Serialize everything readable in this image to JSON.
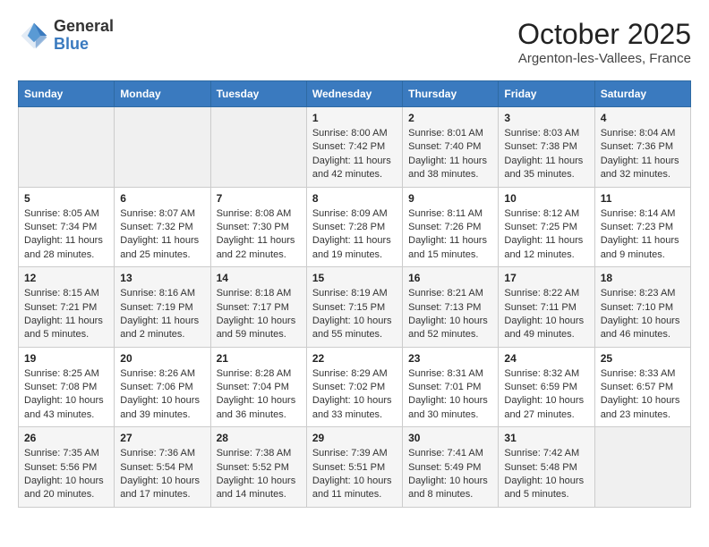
{
  "header": {
    "logo_general": "General",
    "logo_blue": "Blue",
    "month_title": "October 2025",
    "location": "Argenton-les-Vallees, France"
  },
  "days_of_week": [
    "Sunday",
    "Monday",
    "Tuesday",
    "Wednesday",
    "Thursday",
    "Friday",
    "Saturday"
  ],
  "weeks": [
    [
      {
        "day": "",
        "info": ""
      },
      {
        "day": "",
        "info": ""
      },
      {
        "day": "",
        "info": ""
      },
      {
        "day": "1",
        "info": "Sunrise: 8:00 AM\nSunset: 7:42 PM\nDaylight: 11 hours and 42 minutes."
      },
      {
        "day": "2",
        "info": "Sunrise: 8:01 AM\nSunset: 7:40 PM\nDaylight: 11 hours and 38 minutes."
      },
      {
        "day": "3",
        "info": "Sunrise: 8:03 AM\nSunset: 7:38 PM\nDaylight: 11 hours and 35 minutes."
      },
      {
        "day": "4",
        "info": "Sunrise: 8:04 AM\nSunset: 7:36 PM\nDaylight: 11 hours and 32 minutes."
      }
    ],
    [
      {
        "day": "5",
        "info": "Sunrise: 8:05 AM\nSunset: 7:34 PM\nDaylight: 11 hours and 28 minutes."
      },
      {
        "day": "6",
        "info": "Sunrise: 8:07 AM\nSunset: 7:32 PM\nDaylight: 11 hours and 25 minutes."
      },
      {
        "day": "7",
        "info": "Sunrise: 8:08 AM\nSunset: 7:30 PM\nDaylight: 11 hours and 22 minutes."
      },
      {
        "day": "8",
        "info": "Sunrise: 8:09 AM\nSunset: 7:28 PM\nDaylight: 11 hours and 19 minutes."
      },
      {
        "day": "9",
        "info": "Sunrise: 8:11 AM\nSunset: 7:26 PM\nDaylight: 11 hours and 15 minutes."
      },
      {
        "day": "10",
        "info": "Sunrise: 8:12 AM\nSunset: 7:25 PM\nDaylight: 11 hours and 12 minutes."
      },
      {
        "day": "11",
        "info": "Sunrise: 8:14 AM\nSunset: 7:23 PM\nDaylight: 11 hours and 9 minutes."
      }
    ],
    [
      {
        "day": "12",
        "info": "Sunrise: 8:15 AM\nSunset: 7:21 PM\nDaylight: 11 hours and 5 minutes."
      },
      {
        "day": "13",
        "info": "Sunrise: 8:16 AM\nSunset: 7:19 PM\nDaylight: 11 hours and 2 minutes."
      },
      {
        "day": "14",
        "info": "Sunrise: 8:18 AM\nSunset: 7:17 PM\nDaylight: 10 hours and 59 minutes."
      },
      {
        "day": "15",
        "info": "Sunrise: 8:19 AM\nSunset: 7:15 PM\nDaylight: 10 hours and 55 minutes."
      },
      {
        "day": "16",
        "info": "Sunrise: 8:21 AM\nSunset: 7:13 PM\nDaylight: 10 hours and 52 minutes."
      },
      {
        "day": "17",
        "info": "Sunrise: 8:22 AM\nSunset: 7:11 PM\nDaylight: 10 hours and 49 minutes."
      },
      {
        "day": "18",
        "info": "Sunrise: 8:23 AM\nSunset: 7:10 PM\nDaylight: 10 hours and 46 minutes."
      }
    ],
    [
      {
        "day": "19",
        "info": "Sunrise: 8:25 AM\nSunset: 7:08 PM\nDaylight: 10 hours and 43 minutes."
      },
      {
        "day": "20",
        "info": "Sunrise: 8:26 AM\nSunset: 7:06 PM\nDaylight: 10 hours and 39 minutes."
      },
      {
        "day": "21",
        "info": "Sunrise: 8:28 AM\nSunset: 7:04 PM\nDaylight: 10 hours and 36 minutes."
      },
      {
        "day": "22",
        "info": "Sunrise: 8:29 AM\nSunset: 7:02 PM\nDaylight: 10 hours and 33 minutes."
      },
      {
        "day": "23",
        "info": "Sunrise: 8:31 AM\nSunset: 7:01 PM\nDaylight: 10 hours and 30 minutes."
      },
      {
        "day": "24",
        "info": "Sunrise: 8:32 AM\nSunset: 6:59 PM\nDaylight: 10 hours and 27 minutes."
      },
      {
        "day": "25",
        "info": "Sunrise: 8:33 AM\nSunset: 6:57 PM\nDaylight: 10 hours and 23 minutes."
      }
    ],
    [
      {
        "day": "26",
        "info": "Sunrise: 7:35 AM\nSunset: 5:56 PM\nDaylight: 10 hours and 20 minutes."
      },
      {
        "day": "27",
        "info": "Sunrise: 7:36 AM\nSunset: 5:54 PM\nDaylight: 10 hours and 17 minutes."
      },
      {
        "day": "28",
        "info": "Sunrise: 7:38 AM\nSunset: 5:52 PM\nDaylight: 10 hours and 14 minutes."
      },
      {
        "day": "29",
        "info": "Sunrise: 7:39 AM\nSunset: 5:51 PM\nDaylight: 10 hours and 11 minutes."
      },
      {
        "day": "30",
        "info": "Sunrise: 7:41 AM\nSunset: 5:49 PM\nDaylight: 10 hours and 8 minutes."
      },
      {
        "day": "31",
        "info": "Sunrise: 7:42 AM\nSunset: 5:48 PM\nDaylight: 10 hours and 5 minutes."
      },
      {
        "day": "",
        "info": ""
      }
    ]
  ]
}
